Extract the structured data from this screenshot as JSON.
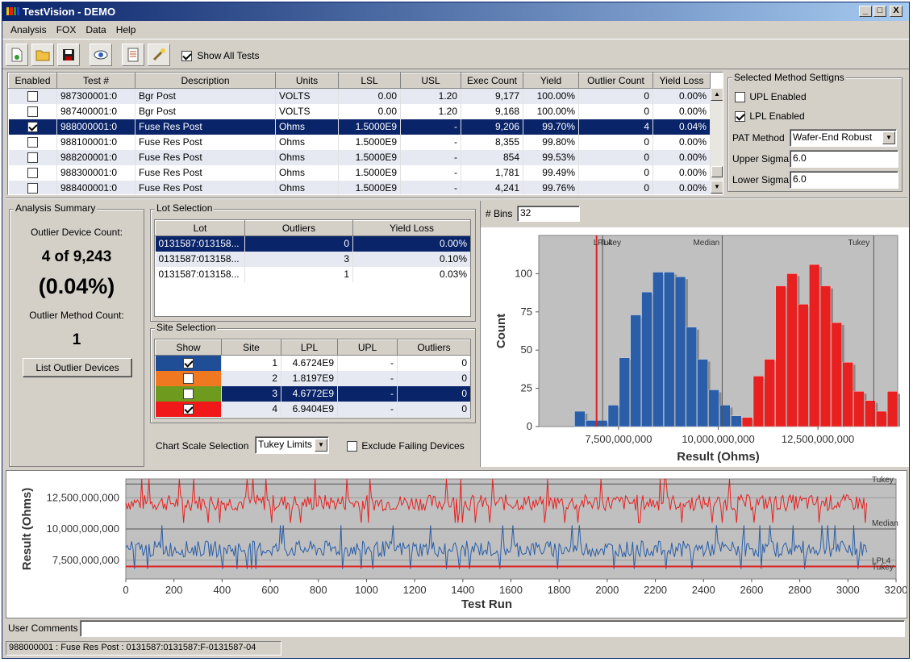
{
  "window": {
    "title": "TestVision - DEMO",
    "controls": [
      "_",
      "□",
      "X"
    ]
  },
  "menu": [
    "Analysis",
    "FOX",
    "Data",
    "Help"
  ],
  "toolbar": {
    "show_all_tests": "Show All Tests",
    "show_all_checked": true
  },
  "tests_table": {
    "headers": [
      "Enabled",
      "Test #",
      "Description",
      "Units",
      "LSL",
      "USL",
      "Exec Count",
      "Yield",
      "Outlier Count",
      "Yield Loss"
    ],
    "rows": [
      {
        "enabled": false,
        "test": "987300001:0",
        "desc": "Bgr Post",
        "units": "VOLTS",
        "lsl": "0.00",
        "usl": "1.20",
        "exec": "9,177",
        "yield": "100.00%",
        "outliers": "0",
        "loss": "0.00%"
      },
      {
        "enabled": false,
        "test": "987400001:0",
        "desc": "Bgr Post",
        "units": "VOLTS",
        "lsl": "0.00",
        "usl": "1.20",
        "exec": "9,168",
        "yield": "100.00%",
        "outliers": "0",
        "loss": "0.00%"
      },
      {
        "enabled": true,
        "test": "988000001:0",
        "desc": "Fuse Res Post",
        "units": "Ohms",
        "lsl": "1.5000E9",
        "usl": "-",
        "exec": "9,206",
        "yield": "99.70%",
        "outliers": "4",
        "loss": "0.04%"
      },
      {
        "enabled": false,
        "test": "988100001:0",
        "desc": "Fuse Res Post",
        "units": "Ohms",
        "lsl": "1.5000E9",
        "usl": "-",
        "exec": "8,355",
        "yield": "99.80%",
        "outliers": "0",
        "loss": "0.00%"
      },
      {
        "enabled": false,
        "test": "988200001:0",
        "desc": "Fuse Res Post",
        "units": "Ohms",
        "lsl": "1.5000E9",
        "usl": "-",
        "exec": "854",
        "yield": "99.53%",
        "outliers": "0",
        "loss": "0.00%"
      },
      {
        "enabled": false,
        "test": "988300001:0",
        "desc": "Fuse Res Post",
        "units": "Ohms",
        "lsl": "1.5000E9",
        "usl": "-",
        "exec": "1,781",
        "yield": "99.49%",
        "outliers": "0",
        "loss": "0.00%"
      },
      {
        "enabled": false,
        "test": "988400001:0",
        "desc": "Fuse Res Post",
        "units": "Ohms",
        "lsl": "1.5000E9",
        "usl": "-",
        "exec": "4,241",
        "yield": "99.76%",
        "outliers": "0",
        "loss": "0.00%"
      }
    ],
    "selected_index": 2
  },
  "method_settings": {
    "title": "Selected Method Settigns",
    "upl_label": "UPL Enabled",
    "upl_checked": false,
    "lpl_label": "LPL Enabled",
    "lpl_checked": true,
    "pat_label": "PAT Method",
    "pat_value": "Wafer-End Robust",
    "upper_label": "Upper Sigma",
    "upper_value": "6.0",
    "lower_label": "Lower Sigma",
    "lower_value": "6.0"
  },
  "summary": {
    "title": "Analysis Summary",
    "outlier_device_label": "Outlier Device Count:",
    "outlier_device_count": "4 of 9,243",
    "outlier_pct": "(0.04%)",
    "method_count_label": "Outlier Method Count:",
    "method_count": "1",
    "list_button": "List Outlier Devices"
  },
  "lot_selection": {
    "title": "Lot Selection",
    "headers": [
      "Lot",
      "Outliers",
      "Yield Loss"
    ],
    "rows": [
      {
        "lot": "0131587:013158...",
        "outliers": "0",
        "loss": "0.00%"
      },
      {
        "lot": "0131587:013158...",
        "outliers": "3",
        "loss": "0.10%"
      },
      {
        "lot": "0131587:013158...",
        "outliers": "1",
        "loss": "0.03%"
      }
    ]
  },
  "site_selection": {
    "title": "Site Selection",
    "headers": [
      "Show",
      "Site",
      "LPL",
      "UPL",
      "Outliers"
    ],
    "rows": [
      {
        "color": "#1f4e96",
        "show": true,
        "site": "1",
        "lpl": "4.6724E9",
        "upl": "-",
        "outliers": "0"
      },
      {
        "color": "#f07820",
        "show": false,
        "site": "2",
        "lpl": "1.8197E9",
        "upl": "-",
        "outliers": "0"
      },
      {
        "color": "#6e9a1e",
        "show": false,
        "site": "3",
        "lpl": "4.6772E9",
        "upl": "-",
        "outliers": "0"
      },
      {
        "color": "#f01818",
        "show": true,
        "site": "4",
        "lpl": "6.9404E9",
        "upl": "-",
        "outliers": "0"
      }
    ]
  },
  "chart_controls": {
    "scale_label": "Chart Scale Selection",
    "scale_value": "Tukey Limits",
    "exclude_label": "Exclude Failing Devices",
    "exclude_checked": false,
    "bins_label": "# Bins",
    "bins_value": "32"
  },
  "chart_data": [
    {
      "type": "bar",
      "subtype": "histogram",
      "xlabel": "Result (Ohms)",
      "ylabel": "Count",
      "x_ticks": [
        7500000000,
        10000000000,
        12500000000
      ],
      "x_tick_labels": [
        "7,500,000,000",
        "10,000,000,000",
        "12,500,000,000"
      ],
      "xlim": [
        5500000000,
        14500000000
      ],
      "ylim": [
        0,
        125
      ],
      "y_ticks": [
        0,
        25,
        50,
        75,
        100
      ],
      "annotations": [
        {
          "label": "LPL4",
          "x": 6950000000
        },
        {
          "label": "Tukey",
          "x": 7100000000
        },
        {
          "label": "Median",
          "x": 10100000000
        },
        {
          "label": "Tukey",
          "x": 13900000000
        }
      ],
      "grid": false,
      "series": [
        {
          "color": "#2a5ea8",
          "bins": [
            6400000000,
            6680000000,
            6960000000,
            7240000000,
            7520000000,
            7800000000,
            8080000000,
            8360000000,
            8640000000,
            8920000000,
            9200000000,
            9480000000,
            9760000000,
            10040000000,
            10320000000
          ],
          "values": [
            10,
            4,
            4,
            14,
            45,
            73,
            88,
            101,
            101,
            98,
            65,
            44,
            24,
            14,
            7
          ]
        },
        {
          "color": "#e82020",
          "bins": [
            10600000000,
            10880000000,
            11160000000,
            11440000000,
            11720000000,
            12000000000,
            12280000000,
            12560000000,
            12840000000,
            13120000000,
            13400000000,
            13680000000,
            13960000000,
            14240000000
          ],
          "values": [
            6,
            33,
            44,
            92,
            100,
            80,
            106,
            92,
            68,
            42,
            23,
            17,
            10,
            23
          ]
        }
      ]
    },
    {
      "type": "line",
      "xlabel": "Test Run",
      "ylabel": "Result (Ohms)",
      "xlim": [
        0,
        3200
      ],
      "x_ticks": [
        0,
        200,
        400,
        600,
        800,
        1000,
        1200,
        1400,
        1600,
        1800,
        2000,
        2200,
        2400,
        2600,
        2800,
        3000,
        3200
      ],
      "ylim": [
        6000000000,
        14000000000
      ],
      "y_ticks": [
        7500000000,
        10000000000,
        12500000000
      ],
      "y_tick_labels": [
        "7,500,000,000",
        "10,000,000,000",
        "12,500,000,000"
      ],
      "reference_lines": [
        {
          "label": "Tukey",
          "y": 13600000000
        },
        {
          "label": "Median",
          "y": 10000000000
        },
        {
          "label": "LPL4",
          "y": 7000000000
        },
        {
          "label": "Tukey",
          "y": 7000000000
        }
      ],
      "series": [
        {
          "color": "#e82020",
          "center": 12100000000,
          "spread": 650000000,
          "spikes_up": 14000000000,
          "spikes_down": 10500000000,
          "x_end": 3080
        },
        {
          "color": "#2a5ea8",
          "center": 8400000000,
          "spread": 650000000,
          "spikes_up": 10300000000,
          "spikes_down": 6800000000,
          "x_end": 3080
        }
      ]
    }
  ],
  "comments": {
    "label": "User Comments",
    "value": ""
  },
  "status": "988000001 : Fuse Res Post : 0131587:0131587:F-0131587-04"
}
